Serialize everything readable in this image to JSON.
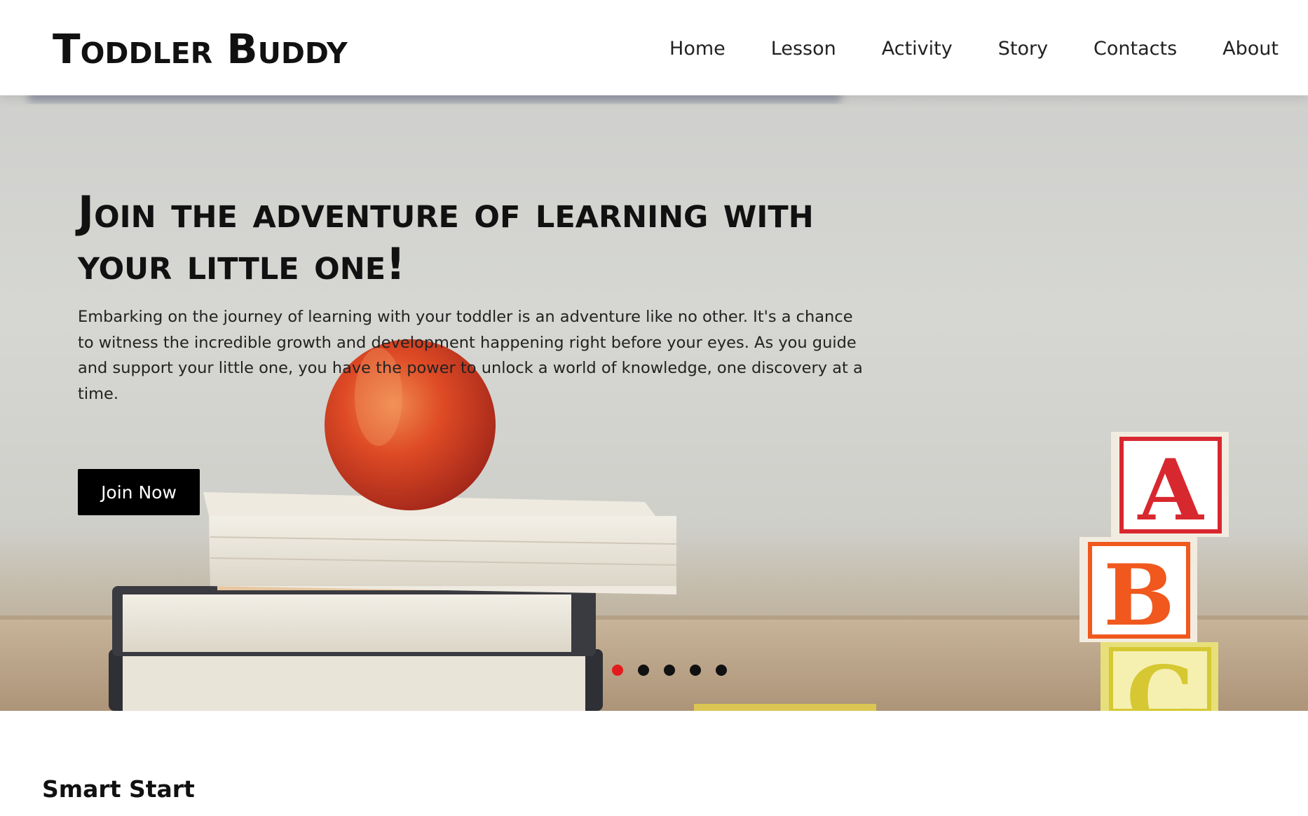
{
  "brand": {
    "name": "Toddler Buddy"
  },
  "nav": {
    "items": [
      "Home",
      "Lesson",
      "Activity",
      "Story",
      "Contacts",
      "About"
    ]
  },
  "hero": {
    "title": "Join the adventure of learning with your little one!",
    "description": "Embarking on the journey of learning with your toddler is an adventure like no other. It's a chance to witness the incredible growth and development happening right before your eyes. As you guide and support your little one, you have the power to unlock a world of knowledge, one discovery at a time.",
    "cta_label": "Join Now",
    "slides": {
      "count": 5,
      "active_index": 0
    },
    "image_letters": [
      "A",
      "B",
      "C"
    ]
  },
  "section": {
    "title": "Smart Start"
  },
  "colors": {
    "accent_dot": "#e21c1c",
    "button_bg": "#000000",
    "button_text": "#ffffff",
    "text": "#111111"
  },
  "icons": {
    "hero_image": "apple-on-books-with-abc-blocks-photo"
  }
}
